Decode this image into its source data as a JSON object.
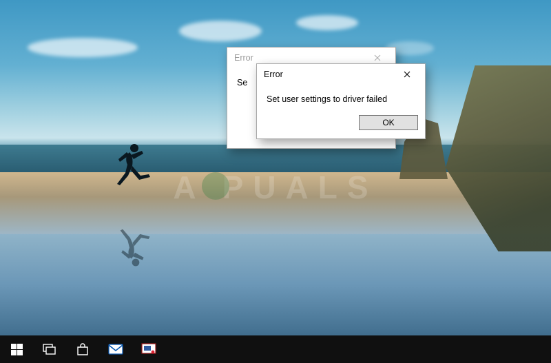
{
  "watermark_text": "A   PUALS",
  "dialog_back": {
    "title": "Error",
    "message_partial": "Se"
  },
  "dialog_front": {
    "title": "Error",
    "message": "Set user settings to driver failed",
    "ok_label": "OK"
  },
  "taskbar": {
    "items": [
      {
        "name": "start-button"
      },
      {
        "name": "task-view-button"
      },
      {
        "name": "store-app"
      },
      {
        "name": "mail-app"
      },
      {
        "name": "snipping-app"
      }
    ]
  }
}
